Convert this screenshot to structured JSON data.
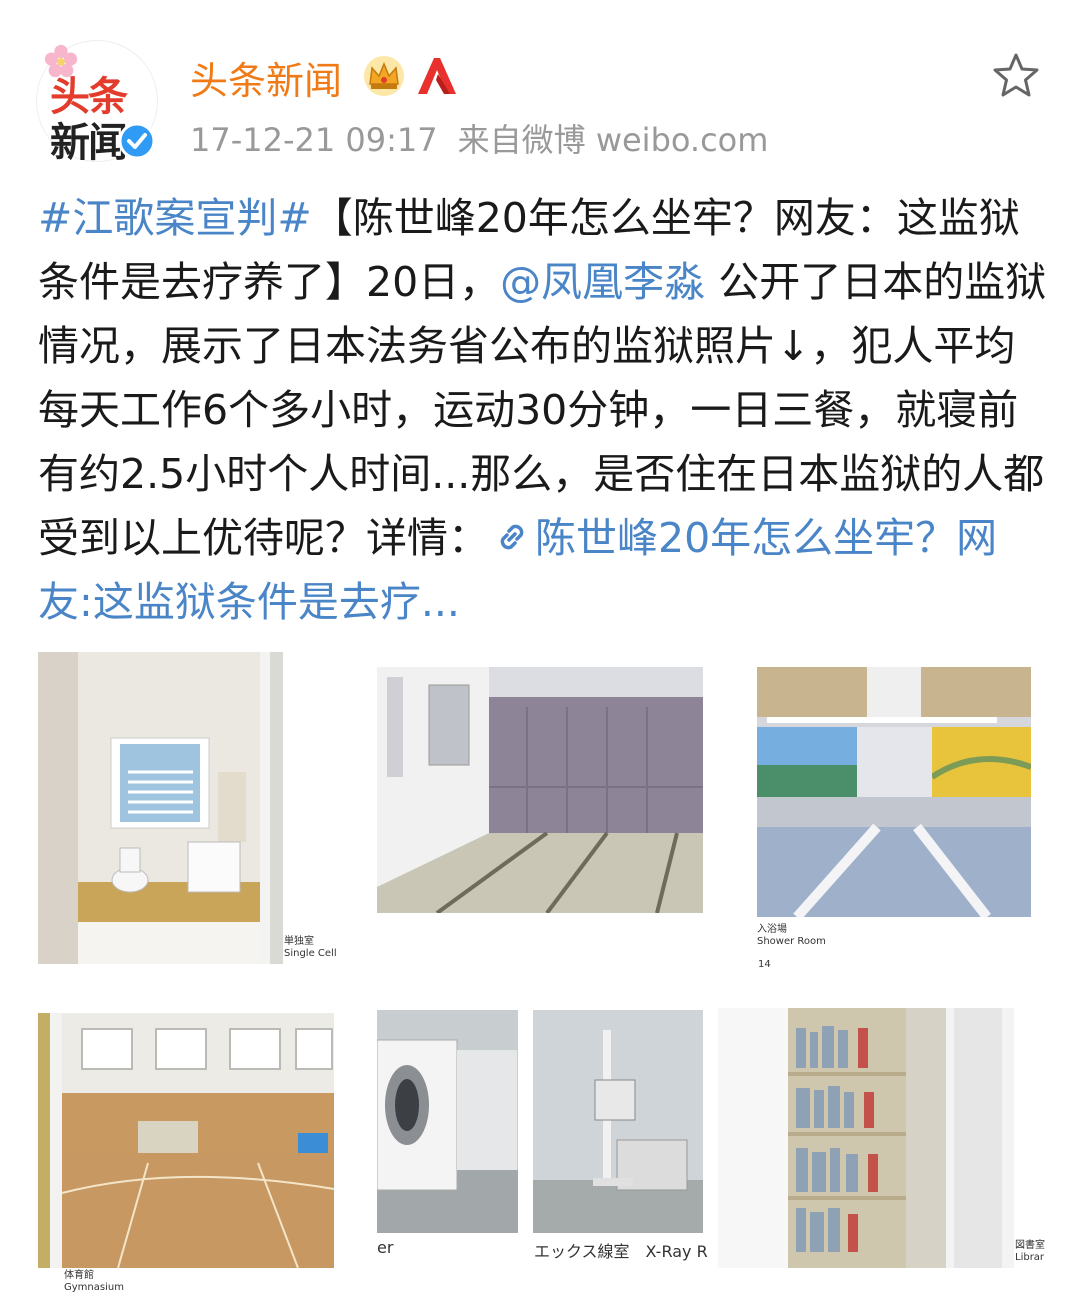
{
  "header": {
    "avatar_line1": "头条",
    "avatar_line2": "新闻",
    "user_name": "头条新闻",
    "date": "17-12-21 09:17",
    "source": "来自微博 weibo.com"
  },
  "post": {
    "topic": "#江歌案宣判#",
    "text_1": "【陈世峰20年怎么坐牢？网友：这监狱条件是去疗养了】20日，",
    "mention": "@凤凰李淼",
    "text_2": " 公开了日本的监狱情况，展示了日本法务省公布的监狱照片↓，犯人平均每天工作6个多小时，运动30分钟，一日三餐，就寝前有约2.5小时个人时间...那么，是否住在日本监狱的人都受到以上优待呢？详情：",
    "link_text": "陈世峰20年怎么坐牢？网友:这监狱条件是去疗..."
  },
  "photos": {
    "single_cell_jp": "単独室",
    "single_cell_en": "Single Cell",
    "shower_jp": "入浴場",
    "shower_en": "Shower Room",
    "page_num": "14",
    "gym_jp": "体育館",
    "gym_en": "Gymnasium",
    "xray_left": "er",
    "xray_label": "エックス線室　X-Ray R",
    "library_jp": "図書室",
    "library_en": "Librar"
  },
  "icons": [
    "blossom-icon",
    "verified-icon",
    "crown-icon",
    "red-a-icon",
    "star-icon",
    "link-icon"
  ],
  "colors": {
    "accent_blue": "#4a85c7",
    "username_orange": "#f07a16",
    "meta_gray": "#999999"
  }
}
